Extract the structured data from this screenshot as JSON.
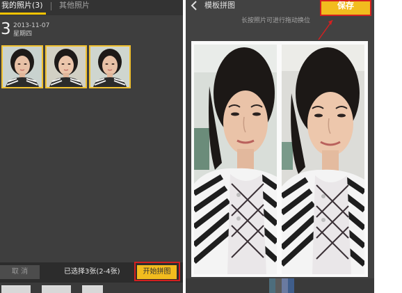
{
  "left_panel": {
    "tabs": {
      "mine": "我的照片(3)",
      "other": "其他照片"
    },
    "group": {
      "day": "3",
      "date": "2013-11-07",
      "weekday": "星期四"
    },
    "thumbnails_count": 3,
    "bottom_bar": {
      "cancel_label": "取 消",
      "selected_text": "已选择3张(2-4张)",
      "start_label": "开始拼图"
    }
  },
  "right_panel": {
    "title": "模板拼图",
    "save_label": "保存",
    "hint": "长按照片可进行拖动换位"
  },
  "colors": {
    "accent": "#f2bc1e",
    "highlight": "#d42020",
    "panel_bg": "#3e3e3e"
  },
  "icons": {
    "back": "chevron-left-icon"
  }
}
